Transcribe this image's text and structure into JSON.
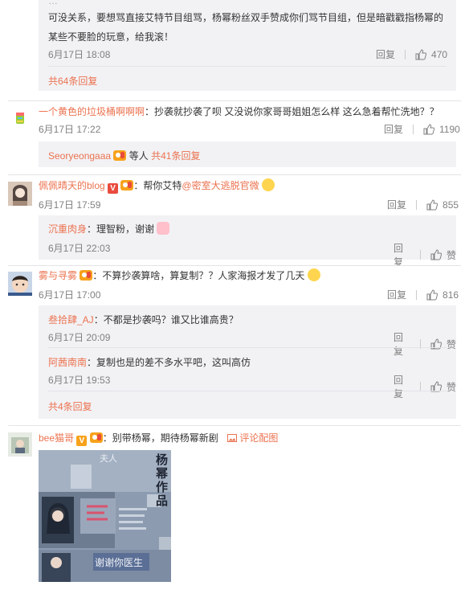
{
  "top_reply": {
    "text_line0": "…",
    "text_line1": "可没关系，要想骂直接艾特节目组骂，杨幂粉丝双手赞成你们骂节目组，但是暗戳戳指杨幂的",
    "text_line2": "某些不要脸的玩意，给我滚！",
    "date": "6月17日 18:08",
    "reply_label": "回复",
    "like_count": "470",
    "more_replies": "共64条回复"
  },
  "comments": [
    {
      "user": "一个黄色的垃圾桶啊啊啊",
      "text": "：抄袭就抄袭了呗 又没说你家哥哥姐姐怎么样 这么急着帮忙洗地？？",
      "date": "6月17日 17:22",
      "reply_label": "回复",
      "like_count": "1190",
      "preview_user": "Seoryeongaaa",
      "preview_text": "等人",
      "preview_link": "共41条回复"
    },
    {
      "user": "佩佩晴天的blog",
      "text": "：帮你艾特",
      "mention": "@密室大逃脱官微",
      "date": "6月17日 17:59",
      "reply_label": "回复",
      "like_count": "855",
      "replies": [
        {
          "user": "沉重肉身",
          "text": "：理智粉，谢谢",
          "date": "6月17日 22:03",
          "reply_label": "回复",
          "like_label": "赞"
        }
      ]
    },
    {
      "user": "雾与寻雾",
      "text": "：不算抄袭算啥，算复制？？人家海报才发了几天",
      "date": "6月17日 17:00",
      "reply_label": "回复",
      "like_count": "816",
      "replies": [
        {
          "user": "叁拾肆_AJ",
          "text": "：不都是抄袭吗？谁又比谁高贵？",
          "date": "6月17日 20:09",
          "reply_label": "回复",
          "like_label": "赞"
        },
        {
          "user": "阿茜南南",
          "text": "：复制也是的差不多水平吧，这叫高仿",
          "date": "6月17日 19:53",
          "reply_label": "回复",
          "like_label": "赞"
        }
      ],
      "more_replies": "共4条回复"
    },
    {
      "user": "bee猫哥",
      "text": "：别带杨幂，期待杨幂新剧",
      "pic_link": "评论配图",
      "image": {
        "text_a": "夫人",
        "text_b": "杨幂作品",
        "text_c": "谢谢你医生"
      }
    }
  ],
  "colors": {
    "accent": "#eb7350",
    "gray_panel": "#f2f2f5",
    "meta": "#808080",
    "vip": "#f7a21b",
    "vip_red": "#e94b3c"
  },
  "icons": [
    "thumb-up-icon",
    "picture-icon",
    "vip-badge-icon",
    "fan-badge-icon",
    "emoji-icon"
  ]
}
